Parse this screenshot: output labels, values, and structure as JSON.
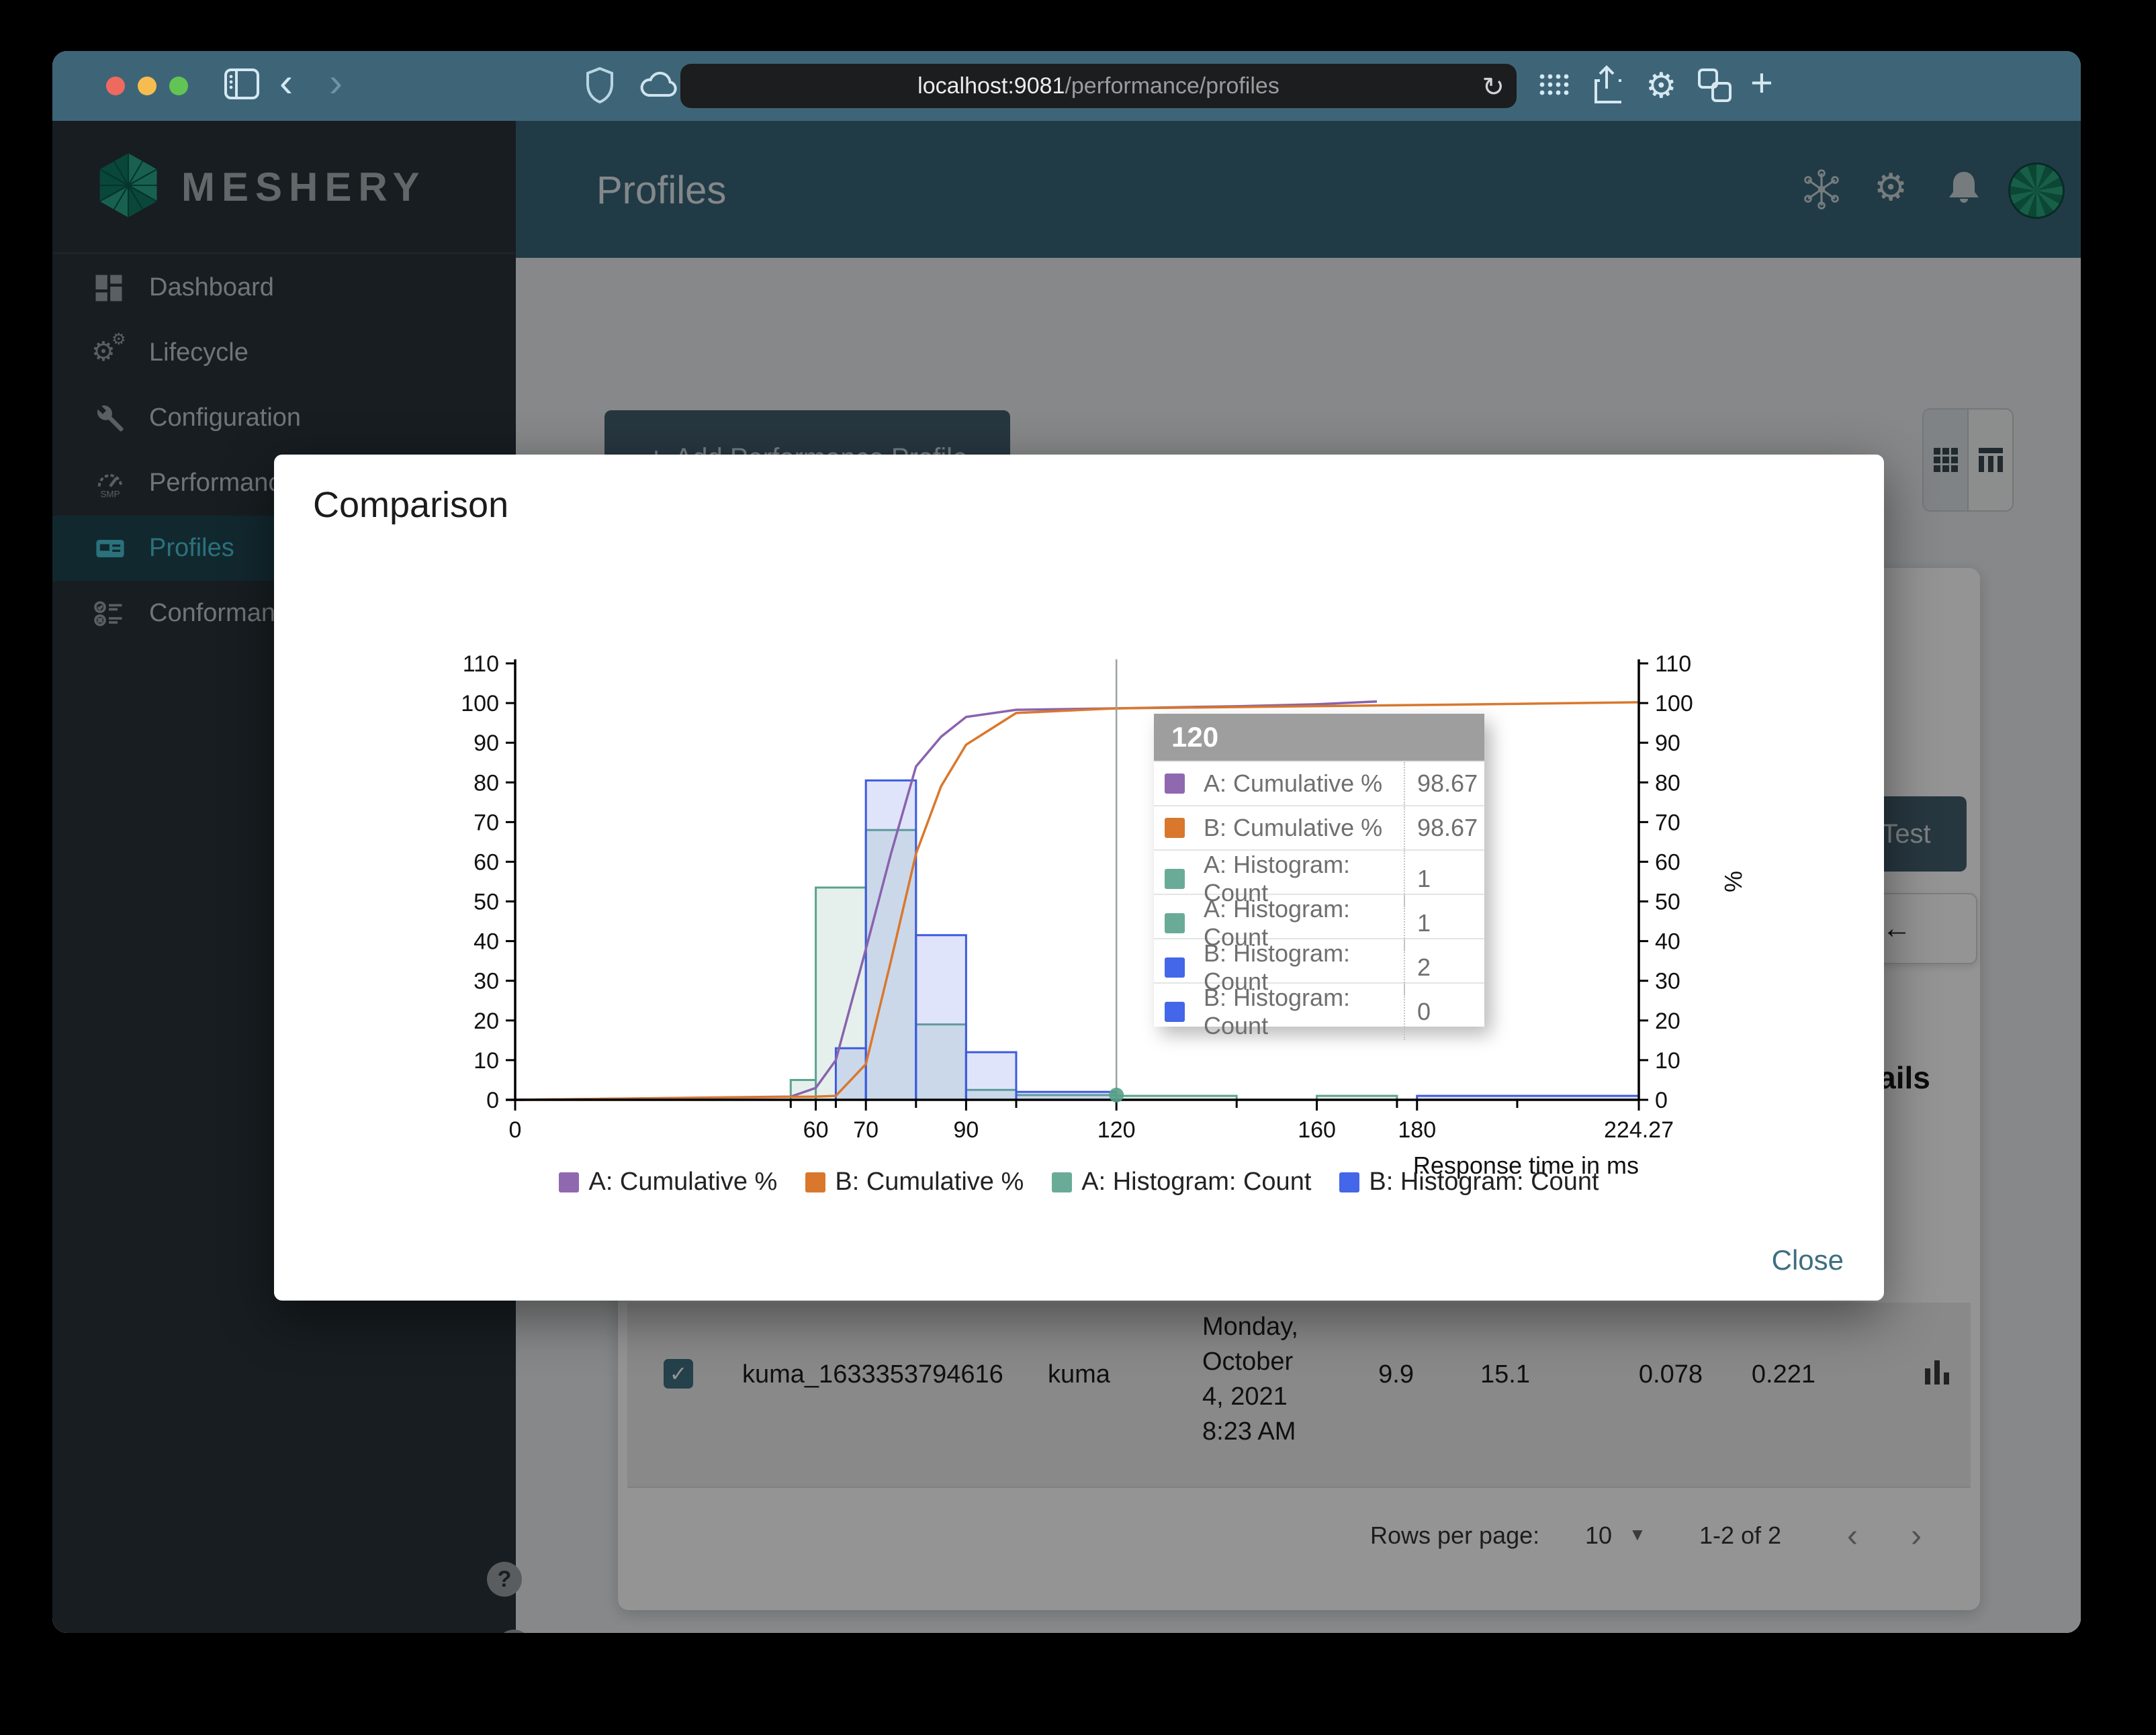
{
  "browser": {
    "url_host": "localhost:9081",
    "url_path": "/performance/profiles"
  },
  "sidebar": {
    "brand": "MESHERY",
    "items": [
      {
        "label": "Dashboard",
        "icon": "dashboard",
        "active": false
      },
      {
        "label": "Lifecycle",
        "icon": "lifecycle",
        "active": false
      },
      {
        "label": "Configuration",
        "icon": "configuration",
        "active": false
      },
      {
        "label": "Performance",
        "icon": "performance",
        "active": false
      },
      {
        "label": "Profiles",
        "icon": "profiles",
        "active": true
      },
      {
        "label": "Conformance",
        "icon": "conformance",
        "active": false
      }
    ],
    "help_glyph": "?",
    "collapse_glyph": "‹"
  },
  "header": {
    "title": "Profiles"
  },
  "content": {
    "add_button": "Add Performance Profile",
    "test_button": "Test",
    "back_arrow": "←",
    "details_heading": "Details"
  },
  "table": {
    "row": {
      "name": "kuma_1633353794616",
      "mesh": "kuma",
      "date_lines": [
        "Monday,",
        "October",
        "4, 2021",
        "8:23 AM"
      ],
      "qps": "9.9",
      "duration": "15.1",
      "p50": "0.078",
      "p99": "0.221"
    },
    "pagination": {
      "rows_per_page_label": "Rows per page:",
      "rows_per_page": "10",
      "range": "1-2 of 2"
    }
  },
  "modal": {
    "title": "Comparison",
    "close_label": "Close"
  },
  "tooltip": {
    "title": "120",
    "rows": [
      {
        "color": "#9068b0",
        "label": "A: Cumulative %",
        "value": "98.67"
      },
      {
        "color": "#d9782d",
        "label": "B: Cumulative %",
        "value": "98.67"
      },
      {
        "color": "#6aab98",
        "label": "A: Histogram: Count",
        "value": "1"
      },
      {
        "color": "#6aab98",
        "label": "A: Histogram: Count",
        "value": "1"
      },
      {
        "color": "#4466e8",
        "label": "B: Histogram: Count",
        "value": "2"
      },
      {
        "color": "#4466e8",
        "label": "B: Histogram: Count",
        "value": "0"
      }
    ]
  },
  "colors": {
    "chrome": "#3e6577",
    "app_header": "#396679",
    "sidebar": "#28323a",
    "active_item": "#49c5d6",
    "button": "#44606e",
    "close_link": "#3e6e80",
    "tooltip_header": "#9e9e9e"
  },
  "chart_data": {
    "type": "histogram+cumulative",
    "title": "",
    "xlabel": "Response time in ms",
    "right_axis_label": "%",
    "xlim": [
      0,
      224.27
    ],
    "ylim": [
      0,
      110
    ],
    "y_tick_step": 10,
    "x_ticks_labeled": [
      0,
      60,
      70,
      90,
      120,
      160,
      180,
      224.27
    ],
    "x_ticks_minor": [
      55,
      64,
      80,
      100,
      144,
      176,
      200
    ],
    "grid": false,
    "legend_position": "bottom-center",
    "hover_x": 120,
    "hover_dot": {
      "x": 120,
      "y": 1.2,
      "color": "#55a188"
    },
    "series": [
      {
        "name": "A: Cumulative %",
        "type": "line",
        "color": "#8a63ad",
        "swatch": "#9068b0",
        "points": [
          [
            0,
            0
          ],
          [
            55,
            0.8
          ],
          [
            60,
            3
          ],
          [
            64,
            10
          ],
          [
            70,
            38
          ],
          [
            75,
            62
          ],
          [
            80,
            84
          ],
          [
            85,
            91.5
          ],
          [
            90,
            96.5
          ],
          [
            100,
            98.3
          ],
          [
            120,
            98.67
          ],
          [
            144,
            99.2
          ],
          [
            160,
            99.7
          ],
          [
            172,
            100.4
          ]
        ]
      },
      {
        "name": "B: Cumulative %",
        "type": "line",
        "color": "#d9782d",
        "swatch": "#d9782d",
        "points": [
          [
            0,
            0
          ],
          [
            60,
            0.8
          ],
          [
            64,
            1
          ],
          [
            70,
            9
          ],
          [
            75,
            35
          ],
          [
            80,
            62
          ],
          [
            85,
            79
          ],
          [
            90,
            89.5
          ],
          [
            100,
            97.5
          ],
          [
            120,
            98.67
          ],
          [
            144,
            99
          ],
          [
            180,
            99.5
          ],
          [
            200,
            99.8
          ],
          [
            224.27,
            100.2
          ]
        ]
      },
      {
        "name": "A: Histogram: Count",
        "type": "histogram",
        "color": "#5da28f",
        "fill": "rgba(109,170,150,0.18)",
        "swatch": "#6aab98",
        "bins": [
          [
            55,
            60,
            5
          ],
          [
            60,
            70,
            53.5
          ],
          [
            70,
            80,
            68
          ],
          [
            80,
            90,
            19
          ],
          [
            90,
            100,
            2.5
          ],
          [
            100,
            120,
            1.2
          ],
          [
            120,
            144,
            1
          ],
          [
            160,
            176,
            1
          ]
        ]
      },
      {
        "name": "B: Histogram: Count",
        "type": "histogram",
        "color": "#3d5bde",
        "fill": "rgba(100,120,230,0.20)",
        "swatch": "#4466e8",
        "bins": [
          [
            64,
            70,
            13
          ],
          [
            70,
            80,
            80.5
          ],
          [
            80,
            90,
            41.5
          ],
          [
            90,
            100,
            12
          ],
          [
            100,
            120,
            2
          ],
          [
            180,
            224.27,
            1
          ]
        ]
      }
    ]
  }
}
